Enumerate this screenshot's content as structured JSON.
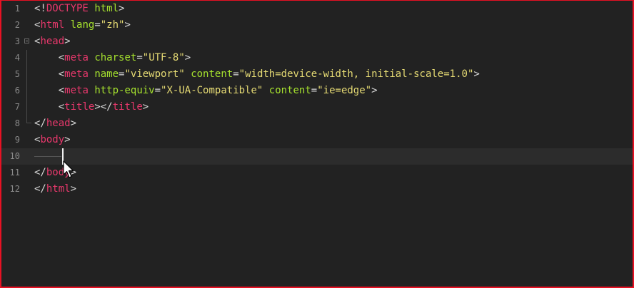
{
  "editor": {
    "lines": [
      {
        "num": "1",
        "segs": [
          [
            "p",
            "<!"
          ],
          [
            "t",
            "DOCTYPE"
          ],
          [
            "p",
            " "
          ],
          [
            "a",
            "html"
          ],
          [
            "p",
            ">"
          ]
        ]
      },
      {
        "num": "2",
        "segs": [
          [
            "p",
            "<"
          ],
          [
            "t",
            "html"
          ],
          [
            "p",
            " "
          ],
          [
            "a",
            "lang"
          ],
          [
            "p",
            "="
          ],
          [
            "s",
            "\"zh\""
          ],
          [
            "p",
            ">"
          ]
        ]
      },
      {
        "num": "3",
        "segs": [
          [
            "p",
            "<"
          ],
          [
            "t",
            "head"
          ],
          [
            "p",
            ">"
          ]
        ]
      },
      {
        "num": "4",
        "segs": [
          [
            "p",
            "    <"
          ],
          [
            "t",
            "meta"
          ],
          [
            "p",
            " "
          ],
          [
            "a",
            "charset"
          ],
          [
            "p",
            "="
          ],
          [
            "s",
            "\"UTF-8\""
          ],
          [
            "p",
            ">"
          ]
        ]
      },
      {
        "num": "5",
        "segs": [
          [
            "p",
            "    <"
          ],
          [
            "t",
            "meta"
          ],
          [
            "p",
            " "
          ],
          [
            "a",
            "name"
          ],
          [
            "p",
            "="
          ],
          [
            "s",
            "\"viewport\""
          ],
          [
            "p",
            " "
          ],
          [
            "a",
            "content"
          ],
          [
            "p",
            "="
          ],
          [
            "s",
            "\"width=device-width, initial-scale=1.0\""
          ],
          [
            "p",
            ">"
          ]
        ]
      },
      {
        "num": "6",
        "segs": [
          [
            "p",
            "    <"
          ],
          [
            "t",
            "meta"
          ],
          [
            "p",
            " "
          ],
          [
            "a",
            "http-equiv"
          ],
          [
            "p",
            "="
          ],
          [
            "s",
            "\"X-UA-Compatible\""
          ],
          [
            "p",
            " "
          ],
          [
            "a",
            "content"
          ],
          [
            "p",
            "="
          ],
          [
            "s",
            "\"ie=edge\""
          ],
          [
            "p",
            ">"
          ]
        ]
      },
      {
        "num": "7",
        "segs": [
          [
            "p",
            "    <"
          ],
          [
            "t",
            "title"
          ],
          [
            "p",
            "></"
          ],
          [
            "t",
            "title"
          ],
          [
            "p",
            ">"
          ]
        ]
      },
      {
        "num": "8",
        "segs": [
          [
            "p",
            "</"
          ],
          [
            "t",
            "head"
          ],
          [
            "p",
            ">"
          ]
        ]
      },
      {
        "num": "9",
        "segs": [
          [
            "p",
            "<"
          ],
          [
            "t",
            "body"
          ],
          [
            "p",
            ">"
          ]
        ]
      },
      {
        "num": "10",
        "segs": []
      },
      {
        "num": "11",
        "segs": [
          [
            "p",
            "</"
          ],
          [
            "t",
            "body"
          ],
          [
            "p",
            ">"
          ]
        ]
      },
      {
        "num": "12",
        "segs": [
          [
            "p",
            "</"
          ],
          [
            "t",
            "html"
          ],
          [
            "p",
            ">"
          ]
        ]
      }
    ],
    "active_line": 10,
    "colors": {
      "background": "#222222",
      "tag": "#e8386c",
      "attribute": "#a6e22e",
      "string": "#e6db74",
      "punctuation": "#d8d8d8",
      "line_number": "#8a8a8a",
      "window_border": "#e81123"
    }
  }
}
